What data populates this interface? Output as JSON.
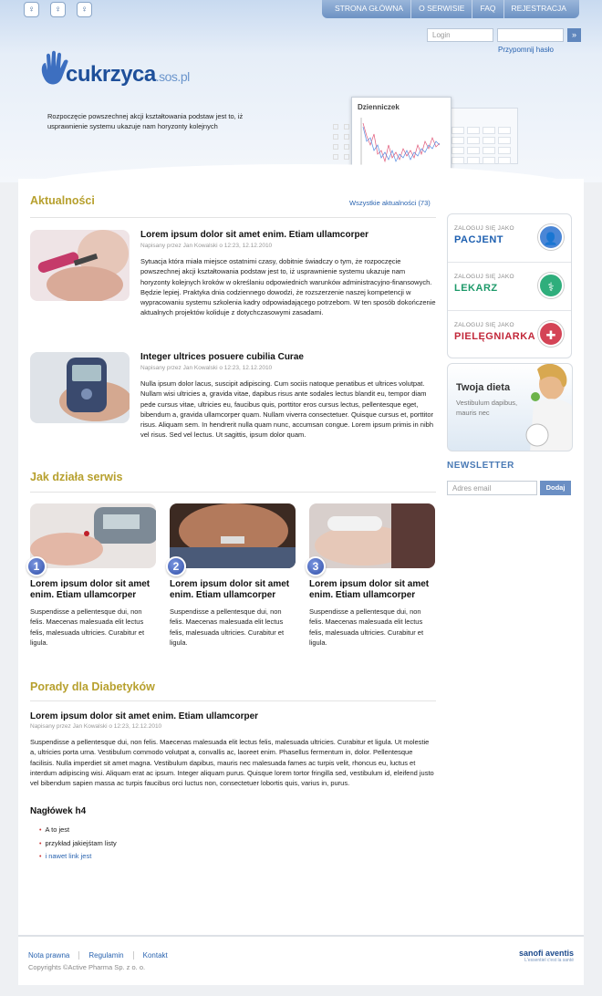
{
  "accessibility": [
    "font-size-icon",
    "font-size-icon",
    "font-size-icon"
  ],
  "topnav": [
    "STRONA GŁÓWNA",
    "O SERWISIE",
    "FAQ",
    "REJESTRACJA"
  ],
  "login": {
    "placeholder": "Login",
    "remind": "Przypomnij hasło"
  },
  "logo": {
    "main": "cukrzyca",
    "suffix": ".sos.pl"
  },
  "intro": "Rozpoczęcie powszechnej akcji kształtowania podstaw jest to, iż usprawnienie systemu ukazuje nam horyzonty kolejnych",
  "diary": {
    "title": "Dzienniczek"
  },
  "news": {
    "title": "Aktualności",
    "all_link": "Wszystkie aktualności (73)",
    "items": [
      {
        "title": "Lorem ipsum dolor sit amet enim. Etiam ullamcorper",
        "meta": "Napisany przez Jan Kowalski o 12:23, 12.12.2010",
        "text": "Sytuacja która miała miejsce ostatnimi czasy, dobitnie świadczy o tym, że rozpoczęcie powszechnej akcji kształtowania podstaw jest to, iż usprawnienie systemu ukazuje nam horyzonty kolejnych kroków w określaniu odpowiednich warunków administracyjno-finansowych. Będzie lepiej. Praktyka dnia codziennego dowodzi, że rozszerzenie naszej kompetencji w wypracowaniu systemu szkolenia kadry odpowiadającego potrzebom. W ten sposób dokończenie aktualnych projektów koliduje z dotychczasowymi zasadami."
      },
      {
        "title": "Integer ultrices posuere cubilia Curae",
        "meta": "Napisany przez Jan Kowalski o 12:23, 12.12.2010",
        "text": "Nulla ipsum dolor lacus, suscipit adipiscing. Cum sociis natoque penatibus et ultrices volutpat. Nullam wisi ultricies a, gravida vitae, dapibus risus ante sodales lectus blandit eu, tempor diam pede cursus vitae, ultricies eu, faucibus quis, porttitor eros cursus lectus, pellentesque eget, bibendum a, gravida ullamcorper quam. Nullam viverra consectetuer. Quisque cursus et, porttitor risus. Aliquam sem. In hendrerit nulla quam nunc, accumsan congue. Lorem ipsum primis in nibh vel risus. Sed vel lectus. Ut sagittis, ipsum dolor quam."
      }
    ]
  },
  "how": {
    "title": "Jak działa serwis",
    "steps": [
      {
        "num": "1",
        "title": "Lorem ipsum dolor sit amet enim. Etiam ullamcorper",
        "text": "Suspendisse a pellentesque dui, non felis. Maecenas malesuada elit lectus felis, malesuada ultricies. Curabitur et ligula."
      },
      {
        "num": "2",
        "title": "Lorem ipsum dolor sit amet enim. Etiam ullamcorper",
        "text": "Suspendisse a pellentesque dui, non felis. Maecenas malesuada elit lectus felis, malesuada ultricies. Curabitur et ligula."
      },
      {
        "num": "3",
        "title": "Lorem ipsum dolor sit amet enim. Etiam ullamcorper",
        "text": "Suspendisse a pellentesque dui, non felis. Maecenas malesuada elit lectus felis, malesuada ultricies. Curabitur et ligula."
      }
    ]
  },
  "tips": {
    "title": "Porady dla Diabetyków",
    "article_title": "Lorem ipsum dolor sit amet enim. Etiam ullamcorper",
    "meta": "Napisany przez Jan Kowalski o 12:23, 12.12.2010",
    "text": "Suspendisse a pellentesque dui, non felis. Maecenas malesuada elit lectus felis, malesuada ultricies. Curabitur et ligula. Ut molestie a, ultricies porta urna. Vestibulum commodo volutpat a, convallis ac, laoreet enim. Phasellus fermentum in, dolor. Pellentesque facilisis. Nulla imperdiet sit amet magna. Vestibulum dapibus, mauris nec malesuada fames ac turpis velit, rhoncus eu, luctus et interdum adipiscing wisi. Aliquam erat ac ipsum. Integer aliquam purus. Quisque lorem tortor fringilla sed, vestibulum id, eleifend justo vel bibendum sapien massa ac turpis faucibus orci luctus non, consectetuer lobortis quis, varius in, purus.",
    "h4": "Nagłówek h4",
    "list": [
      "A to jest",
      "przykład jakiejśtam listy",
      "i nawet link jest"
    ]
  },
  "roles": [
    {
      "small": "ZALOGUJ SIĘ JAKO",
      "big": "PACJENT",
      "color": "#1d5fb0",
      "icon_bg": "#4a86d6"
    },
    {
      "small": "ZALOGUJ SIĘ JAKO",
      "big": "LEKARZ",
      "color": "#1e9a6a",
      "icon_bg": "#2fae7c"
    },
    {
      "small": "ZALOGUJ SIĘ JAKO",
      "big": "PIELĘGNIARKA",
      "color": "#c2283a",
      "icon_bg": "#d44456"
    }
  ],
  "diet": {
    "title": "Twoja dieta",
    "text": "Vestibulum dapibus, mauris nec"
  },
  "newsletter": {
    "title": "NEWSLETTER",
    "placeholder": "Adres email",
    "button": "Dodaj"
  },
  "footer": {
    "links": [
      "Nota prawna",
      "Regulamin",
      "Kontakt"
    ],
    "copyright": "Copyrights ©Active Pharma Sp. z o. o.",
    "sponsor": "sanofi aventis",
    "sponsor_sub": "L'essentiel c'est la santé"
  }
}
